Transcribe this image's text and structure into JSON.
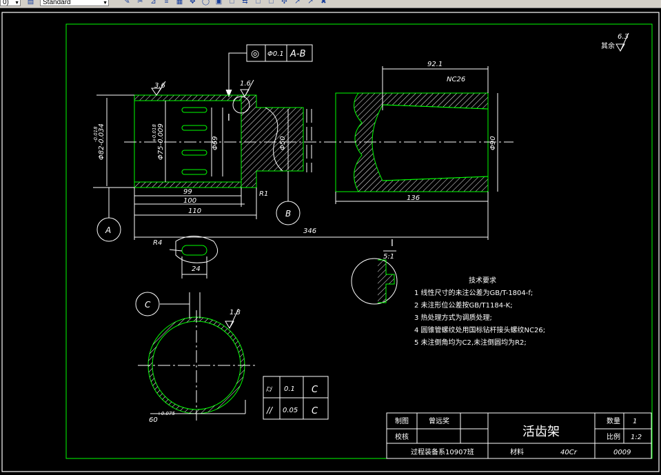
{
  "toolbar": {
    "left_combo": "0)",
    "style_combo": "Standard",
    "buttons": [
      "✎",
      "✂",
      "⊿",
      "≡",
      "▦",
      "✥",
      "◯",
      "▣",
      "□",
      "⇆",
      "□",
      "□",
      "✣",
      "↗",
      "↗",
      "✖"
    ]
  },
  "drawing": {
    "surface_roughness": "6.3",
    "surface_roughness_note": "其余",
    "tolerance_frame": {
      "symbol": "◎",
      "value": "Φ0.1",
      "datum": "A-B"
    },
    "roughness_labels": [
      "3.6",
      "1.6",
      "1.8"
    ],
    "dims": {
      "d82": "Φ82-0.034",
      "d82_upper": "-0.018",
      "d75": "Φ75-0.009",
      "d75_upper": "+0.018",
      "d69": "Φ69",
      "d50": "Φ50",
      "d90": "Φ90",
      "len92": "92.1",
      "nc26": "NC26",
      "len99": "99",
      "len100": "100",
      "len110": "110",
      "len136": "136",
      "len346": "346",
      "r1": "R1",
      "r4": "R4",
      "len24": "24",
      "d60": "60",
      "d60_tol": "+0.075"
    },
    "datum_labels": [
      "A",
      "B",
      "C"
    ],
    "section_label": "I",
    "detail_label": "I",
    "detail_scale": "5:1",
    "form_tol": [
      {
        "symbol": "⌭",
        "value": "0.1",
        "datum": "C"
      },
      {
        "symbol": "//",
        "value": "0.05",
        "datum": "C"
      }
    ],
    "notes_title": "技术要求",
    "notes": [
      "1 线性尺寸的未注公差为GB/T-1804-f;",
      "2 未注形位公差按GB/T1184-K;",
      "3 热处理方式为调质处理;",
      "4 圆锥管螺纹处用国标钻杆接头螺纹NC26;",
      "5 未注倒角均为C2,未注倒圆均为R2;"
    ]
  },
  "title_block": {
    "drawn_label": "制图",
    "drawn_name": "曾远奖",
    "check_label": "校核",
    "part_name": "活齿架",
    "qty_label": "数量",
    "qty_value": "1",
    "scale_label": "比例",
    "scale_value": "1:2",
    "class_name": "过程装备系10907班",
    "material_label": "材料",
    "material_value": "40Cr",
    "drawing_no": "0009"
  }
}
